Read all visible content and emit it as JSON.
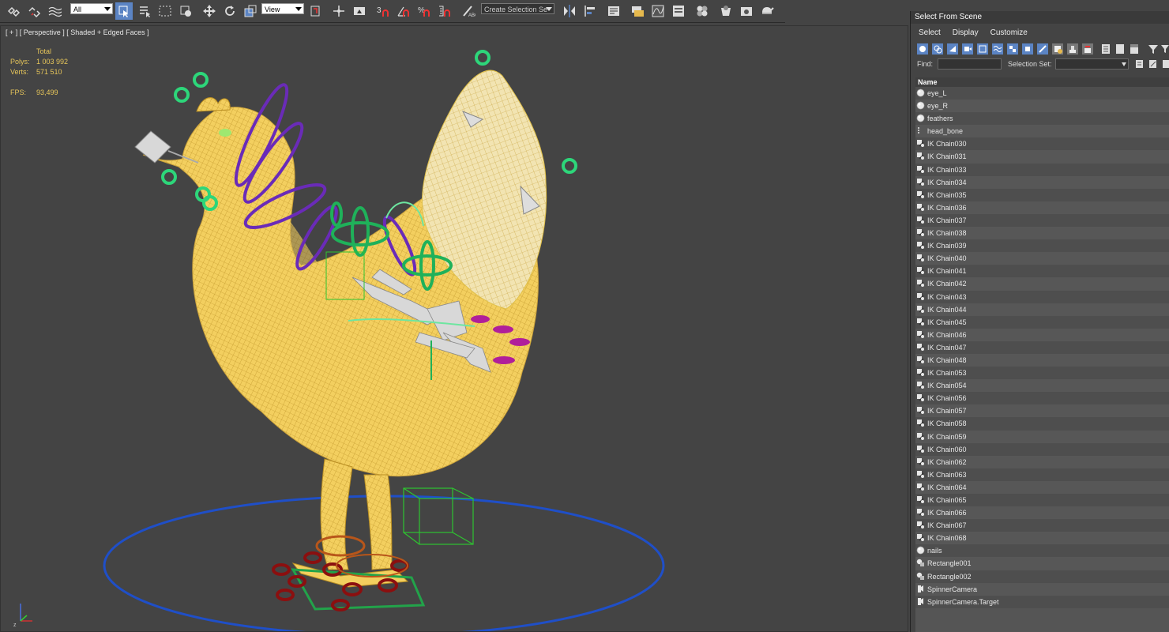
{
  "toolbar": {
    "filter_value": "All",
    "refcoord_value": "View",
    "named_selection_placeholder": "Create Selection Se"
  },
  "viewport": {
    "label": "[ + ] [ Perspective ] [ Shaded + Edged Faces ]",
    "stats": {
      "total_label": "Total",
      "polys_label": "Polys:",
      "polys_value": "1 003 992",
      "verts_label": "Verts:",
      "verts_value": "571 510",
      "fps_label": "FPS:",
      "fps_value": "93,499"
    }
  },
  "panel": {
    "title": "Select From Scene",
    "menu": [
      "Select",
      "Display",
      "Customize"
    ],
    "find_label": "Find:",
    "selection_set_label": "Selection Set:",
    "column_name": "Name",
    "items": [
      {
        "name": "eye_L",
        "icon": "sphere-icon"
      },
      {
        "name": "eye_R",
        "icon": "sphere-icon"
      },
      {
        "name": "feathers",
        "icon": "sphere-icon"
      },
      {
        "name": "head_bone",
        "icon": "bone-icon"
      },
      {
        "name": "IK Chain030",
        "icon": "ik-chain-icon"
      },
      {
        "name": "IK Chain031",
        "icon": "ik-chain-icon"
      },
      {
        "name": "IK Chain033",
        "icon": "ik-chain-icon"
      },
      {
        "name": "IK Chain034",
        "icon": "ik-chain-icon"
      },
      {
        "name": "IK Chain035",
        "icon": "ik-chain-icon"
      },
      {
        "name": "IK Chain036",
        "icon": "ik-chain-icon"
      },
      {
        "name": "IK Chain037",
        "icon": "ik-chain-icon"
      },
      {
        "name": "IK Chain038",
        "icon": "ik-chain-icon"
      },
      {
        "name": "IK Chain039",
        "icon": "ik-chain-icon"
      },
      {
        "name": "IK Chain040",
        "icon": "ik-chain-icon"
      },
      {
        "name": "IK Chain041",
        "icon": "ik-chain-icon"
      },
      {
        "name": "IK Chain042",
        "icon": "ik-chain-icon"
      },
      {
        "name": "IK Chain043",
        "icon": "ik-chain-icon"
      },
      {
        "name": "IK Chain044",
        "icon": "ik-chain-icon"
      },
      {
        "name": "IK Chain045",
        "icon": "ik-chain-icon"
      },
      {
        "name": "IK Chain046",
        "icon": "ik-chain-icon"
      },
      {
        "name": "IK Chain047",
        "icon": "ik-chain-icon"
      },
      {
        "name": "IK Chain048",
        "icon": "ik-chain-icon"
      },
      {
        "name": "IK Chain053",
        "icon": "ik-chain-icon"
      },
      {
        "name": "IK Chain054",
        "icon": "ik-chain-icon"
      },
      {
        "name": "IK Chain056",
        "icon": "ik-chain-icon"
      },
      {
        "name": "IK Chain057",
        "icon": "ik-chain-icon"
      },
      {
        "name": "IK Chain058",
        "icon": "ik-chain-icon"
      },
      {
        "name": "IK Chain059",
        "icon": "ik-chain-icon"
      },
      {
        "name": "IK Chain060",
        "icon": "ik-chain-icon"
      },
      {
        "name": "IK Chain062",
        "icon": "ik-chain-icon"
      },
      {
        "name": "IK Chain063",
        "icon": "ik-chain-icon"
      },
      {
        "name": "IK Chain064",
        "icon": "ik-chain-icon"
      },
      {
        "name": "IK Chain065",
        "icon": "ik-chain-icon"
      },
      {
        "name": "IK Chain066",
        "icon": "ik-chain-icon"
      },
      {
        "name": "IK Chain067",
        "icon": "ik-chain-icon"
      },
      {
        "name": "IK Chain068",
        "icon": "ik-chain-icon"
      },
      {
        "name": "nails",
        "icon": "sphere-icon"
      },
      {
        "name": "Rectangle001",
        "icon": "shape-icon"
      },
      {
        "name": "Rectangle002",
        "icon": "shape-icon"
      },
      {
        "name": "SpinnerCamera",
        "icon": "camera-icon"
      },
      {
        "name": "SpinnerCamera.Target",
        "icon": "camera-icon"
      }
    ]
  },
  "colors": {
    "mesh": "#f5d060",
    "controls_green": "#2dd67a",
    "controls_purple": "#6a2bb8",
    "ground_ring": "#1f4fc8",
    "feet_controls": "#8b0f0f",
    "active_tool": "#5b84c4"
  }
}
